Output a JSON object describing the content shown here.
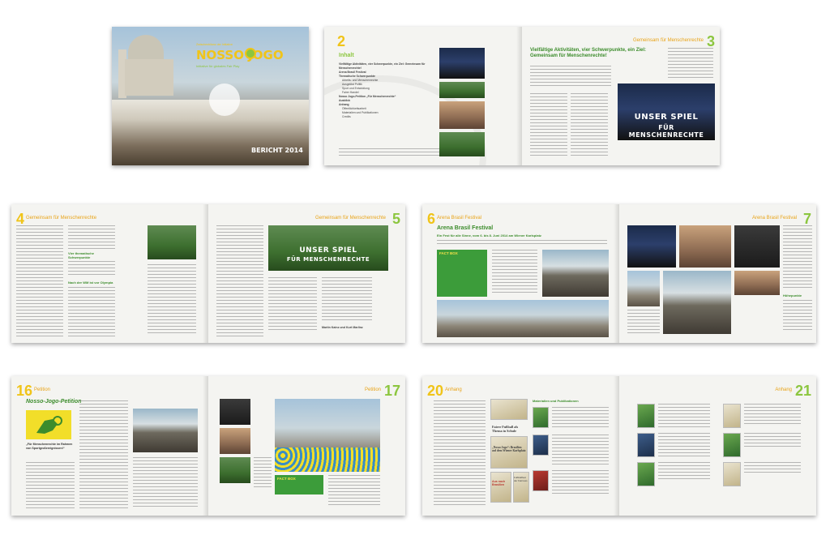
{
  "spread1": {
    "cover_brand": "NOSSO JOGO",
    "cover_tagline": "Initiative für globales Fair Play",
    "cover_small": "Zwischenbilanz der Initiative",
    "cover_report": "BERICHT 2014",
    "page2_num": "2",
    "toc_title": "Inhalt",
    "toc_items": [
      "Vielfältige Aktivitäten, vier Schwerpunkte, ein Ziel: Gemeinsam für Menschenrechte!",
      "Arena Brasil Festival",
      "Thematische Schwerpunkte",
      "Arbeits- und Menschenrechte",
      "Ausgelöst Politik",
      "Sport und Entwicklung",
      "Fairer Handel",
      "Nosso Jogo-Petition „Für Menschenrechte“",
      "Ausblick",
      "Anhang",
      "Öffentlichkeitsarbeit",
      "Materialien und Publikationen",
      "Credits"
    ],
    "page3_head": "Gemeinsam für Menschenrechte",
    "page3_num": "3",
    "page3_title": "Vielfältige Aktivitäten, vier Schwerpunkte, ein Ziel: Gemeinsam für Menschenrechte!",
    "page3_banner_1": "UNSER SPIEL",
    "page3_banner_2": "FÜR MENSCHENRECHTE"
  },
  "spread2": {
    "page4_num": "4",
    "page4_head": "Gemeinsam für Menschenrechte",
    "page4_sub1": "Vier thematische Schwerpunkte",
    "page4_sub2": "Nach der WM ist vor Olympia",
    "page5_head": "Gemeinsam für Menschenrechte",
    "page5_num": "5",
    "page5_banner_1": "UNSER SPIEL",
    "page5_banner_2": "FÜR MENSCHENRECHTE",
    "page5_sign": "Martin Kainz und Kurt Marlinz"
  },
  "spread3": {
    "page6_num": "6",
    "page6_head": "Arena Brasil Festival",
    "page6_title": "Arena Brasil Festival",
    "page6_sub": "Ein Fest für alle Sinne, vom 6. bis 8. Juni 2014 am Wiener Karlsplatz",
    "factbox_title": "FACT BOX",
    "page7_head": "Arena Brasil Festival",
    "page7_num": "7",
    "page7_sub": "Höhepunkte"
  },
  "spread4": {
    "page16_num": "16",
    "page16_head": "Petition",
    "page16_title": "Nosso-Jogo-Petition",
    "page16_quote": "„Für Menschenrechte im Rahmen von Sportgroßereignissen!“",
    "page17_head": "Petition",
    "page17_num": "17",
    "factbox_title": "FACT BOX"
  },
  "spread5": {
    "page20_num": "20",
    "page20_head": "Anhang",
    "page20_sub": "Materialien und Publikationen",
    "pub_title_1": "Fairer Fußball als Thema in Schule",
    "pub_title_2": "„Nosso Jogo“: Brasilien auf dem Wiener Karlsplatz",
    "pub_title_3": "Fußballfest der Fairness",
    "pub_title_4": "Aus nach Brasilien",
    "page21_head": "Anhang",
    "page21_num": "21"
  },
  "colors": {
    "accent_yellow": "#f0c419",
    "accent_green": "#8cc63f",
    "brand_green": "#3c9c3a",
    "orange": "#e8a317"
  }
}
